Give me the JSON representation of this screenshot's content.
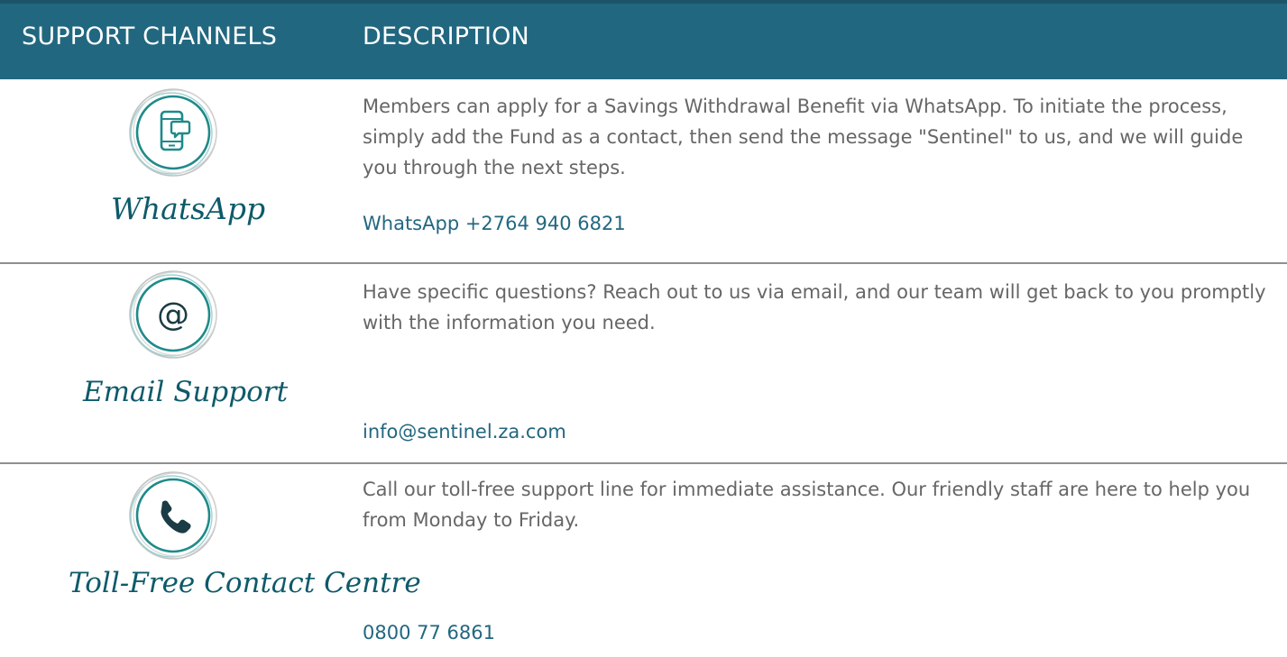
{
  "header": {
    "col_channels": "SUPPORT CHANNELS",
    "col_description": "DESCRIPTION"
  },
  "colors": {
    "header_bg": "#226780",
    "accent_teal": "#1f8a8a",
    "link": "#226780",
    "body_text": "#666666"
  },
  "channels": [
    {
      "icon": "smartphone-chat-icon",
      "name": "WhatsApp",
      "description": "Members can apply for a Savings Withdrawal Benefit via WhatsApp. To initiate the process, simply add the Fund as a contact, then send the message \"Sentinel\" to us, and we will guide you through the next steps.",
      "contact": "WhatsApp +2764 940 6821"
    },
    {
      "icon": "at-sign-icon",
      "name": "Email Support",
      "description": "Have specific questions? Reach out to us via email, and our team will get back to you promptly with the information you need.",
      "contact": "info@sentinel.za.com"
    },
    {
      "icon": "phone-icon",
      "name": "Toll-Free Contact Centre",
      "description": "Call our toll-free support line for immediate assistance. Our friendly staff are here to help you from Monday to Friday.",
      "contact": "0800 77 6861"
    }
  ]
}
